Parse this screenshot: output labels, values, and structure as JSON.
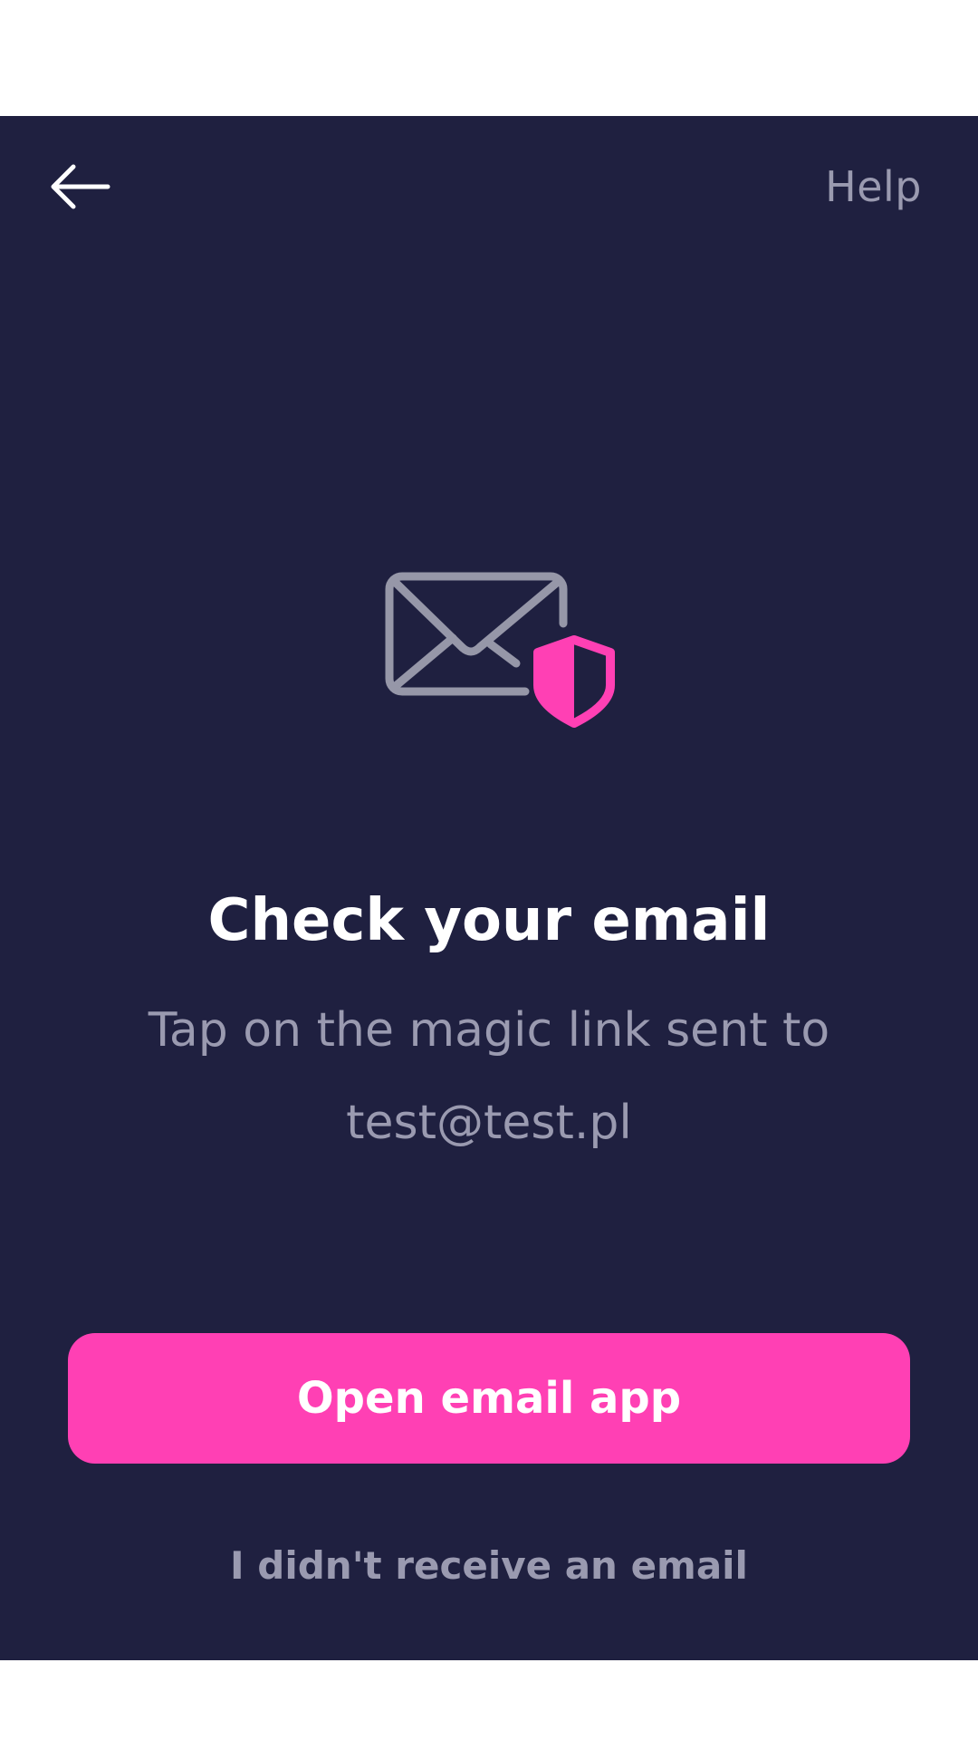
{
  "header": {
    "back_icon": "arrow-left-icon",
    "help_label": "Help"
  },
  "hero": {
    "icon": "email-shield-icon"
  },
  "content": {
    "title": "Check your email",
    "subtitle_line1": "Tap on the magic link sent to",
    "email": "test@test.pl"
  },
  "actions": {
    "open_email_label": "Open email app",
    "not_received_label": "I didn't receive an email"
  },
  "colors": {
    "background": "#1f2040",
    "accent": "#ff40b4",
    "muted_text": "#9a9ab0",
    "title_text": "#ffffff"
  }
}
